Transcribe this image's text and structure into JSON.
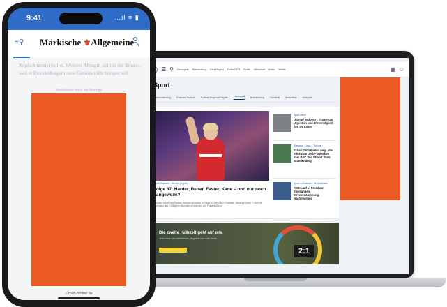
{
  "laptop": {
    "nav": [
      "Neuruppin",
      "Brandenburg",
      "Kiez Region",
      "Fußball-EM",
      "Politik",
      "Wirtschaft",
      "Kultur",
      "Wetter"
    ],
    "section_title": "Sport",
    "subnav": [
      "Ostbrandenburg",
      "Potsdam Fußball",
      "Fußball-Regional Prignitz",
      "Heimsport",
      "Brandenburg",
      "Handball",
      "Basketball",
      "Volleyball"
    ],
    "subnav_active_index": 3,
    "hero": {
      "meta": "Sport Potsdam · Absatz (Kopie)",
      "title": "Folge 87: Harder, Better, Faster, Kane – und nur noch Langeweile?",
      "text": "Benedikt Scholl und Roman Gerhard sprechen in Folge 87 ihres MAZ-Podcasts „Absatz (Kopie) 7“ über die Dominanz des FC Bayern München im Männer- und Frauenfußball."
    },
    "side_items": [
      {
        "kicker": "Sport Arbeit",
        "title": "„Kampf verloren“: Trauer um Urgestein und Ehrenmitglied des SV Anker"
      },
      {
        "kicker": "Potsdam · Union · Turbine",
        "title": "Schon 2000 Karten weg! Alle Infos zum Derby zwischen dem BSC Süd 05 und Stahl Brandenburg"
      },
      {
        "kicker": "Sport in Potsdam · Leichtathletik",
        "title": "RBB-Lauf in Potsdam: Sperrungen, Streckenänderung, Nachmeldung"
      }
    ],
    "banner": {
      "title": "Die zweite Halbzeit geht auf uns",
      "subtitle": "Jetzt ohne Abo weiterlesen, Angebot nur noch heute",
      "score": "2:1"
    }
  },
  "phone": {
    "time": "9:41",
    "status_icons": "…ıl ≡ ▮",
    "brand_left": "Märkische",
    "brand_right": "Allgemeine",
    "article_text": "Kopfschmerzen helfen. Weiterer Almagrit sieht in der Bioseoi, weil er Brandenburgern neue Gemüse nilitr bringen will.",
    "ad_label": "Weiterlesen nach der Anzeige",
    "url": "⌂ maz-online.de"
  },
  "colors": {
    "ad_orange": "#ec5a24",
    "status_blue": "#2f6cc8",
    "eagle_red": "#d63c2a"
  }
}
